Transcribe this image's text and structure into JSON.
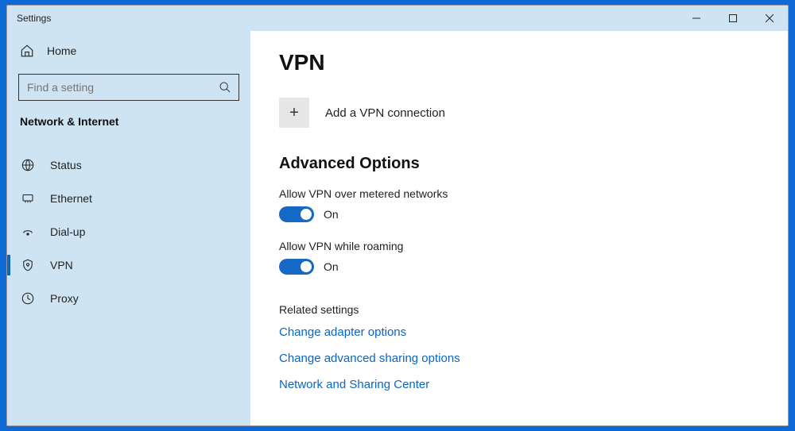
{
  "window": {
    "title": "Settings"
  },
  "sidebar": {
    "home_label": "Home",
    "search_placeholder": "Find a setting",
    "section_label": "Network & Internet",
    "items": [
      {
        "label": "Status"
      },
      {
        "label": "Ethernet"
      },
      {
        "label": "Dial-up"
      },
      {
        "label": "VPN"
      },
      {
        "label": "Proxy"
      }
    ]
  },
  "main": {
    "page_title": "VPN",
    "add_label": "Add a VPN connection",
    "advanced_title": "Advanced Options",
    "option1": {
      "label": "Allow VPN over metered networks",
      "state": "On"
    },
    "option2": {
      "label": "Allow VPN while roaming",
      "state": "On"
    },
    "related_head": "Related settings",
    "links": [
      "Change adapter options",
      "Change advanced sharing options",
      "Network and Sharing Center"
    ]
  }
}
